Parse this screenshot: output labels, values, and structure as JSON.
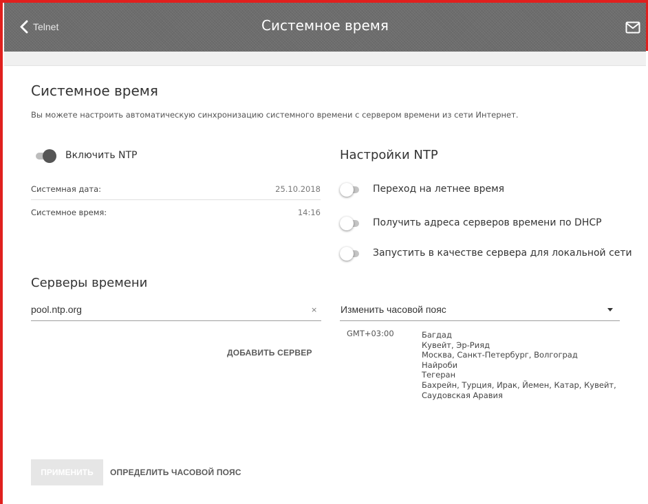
{
  "header": {
    "back_label": "Telnet",
    "title": "Системное время",
    "icons": {
      "back": "chevron-left-icon",
      "mail": "mail-icon"
    }
  },
  "main": {
    "title": "Системное время",
    "description": "Вы можете настроить автоматическую синхронизацию системного времени с сервером времени из сети Интернет."
  },
  "ntp_toggle": {
    "label": "Включить NTP",
    "enabled": true
  },
  "system_info": [
    {
      "label": "Системная дата:",
      "value": "25.10.2018"
    },
    {
      "label": "Системное время:",
      "value": "14:16"
    }
  ],
  "ntp_settings": {
    "title": "Настройки NTP",
    "options": [
      {
        "label": "Переход на летнее время",
        "enabled": false
      },
      {
        "label": "Получить адреса серверов времени по DHCP",
        "enabled": false
      },
      {
        "label": "Запустить в качестве сервера для локальной сети",
        "enabled": false
      }
    ]
  },
  "time_servers": {
    "title": "Серверы времени",
    "server_value": "pool.ntp.org",
    "clear_symbol": "×",
    "add_button": "ДОБАВИТЬ СЕРВЕР"
  },
  "timezone": {
    "select_label": "Изменить часовой пояс",
    "offset": "GMT+03:00",
    "cities": [
      "Багдад",
      "Кувейт, Эр-Рияд",
      "Москва, Санкт-Петербург, Волгоград",
      "Найроби",
      "Тегеран",
      "Бахрейн, Турция, Ирак, Йемен, Катар, Кувейт,",
      "Саудовская Аравия"
    ]
  },
  "footer": {
    "apply_button": "ПРИМЕНИТЬ",
    "detect_button": "ОПРЕДЕЛИТЬ ЧАСОВОЙ ПОЯС"
  },
  "colors": {
    "frame": "#e0201e",
    "header_bg": "#6d6d6d",
    "toggle_on": "#555555"
  }
}
